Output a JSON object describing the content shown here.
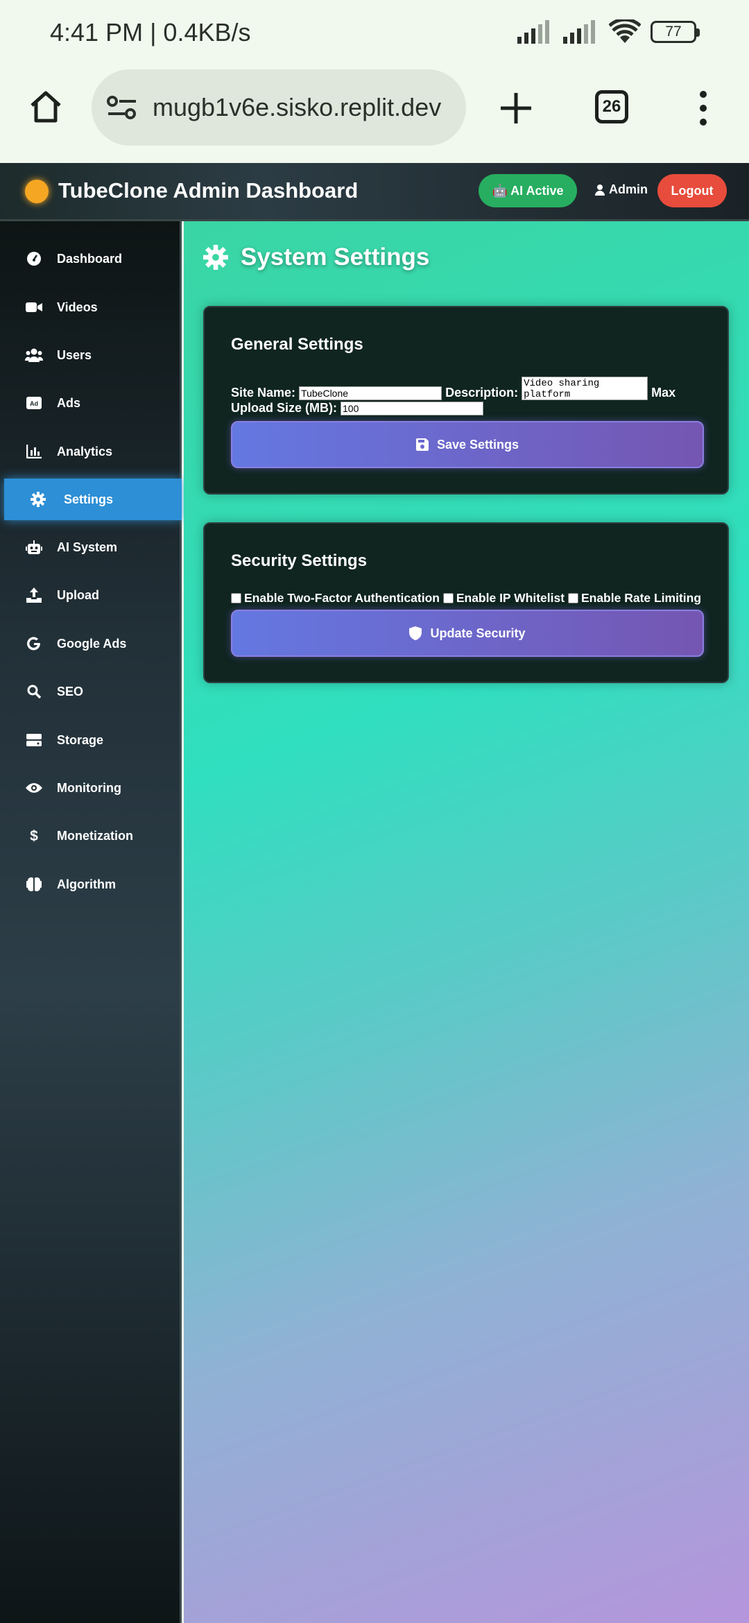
{
  "status_bar": {
    "time": "4:41 PM | 0.4KB/s",
    "battery": "77"
  },
  "browser": {
    "url": "mugb1v6e.sisko.replit.dev",
    "tab_count": "26"
  },
  "header": {
    "title": "TubeClone Admin Dashboard",
    "ai_badge": "🤖 AI Active",
    "admin_label": "Admin",
    "logout_label": "Logout"
  },
  "sidebar": {
    "items": [
      {
        "label": "Dashboard",
        "icon": "gauge-icon"
      },
      {
        "label": "Videos",
        "icon": "video-icon"
      },
      {
        "label": "Users",
        "icon": "users-icon"
      },
      {
        "label": "Ads",
        "icon": "ad-icon"
      },
      {
        "label": "Analytics",
        "icon": "chart-icon"
      },
      {
        "label": "Settings",
        "icon": "gear-icon",
        "active": true
      },
      {
        "label": "AI System",
        "icon": "robot-icon"
      },
      {
        "label": "Upload",
        "icon": "upload-icon"
      },
      {
        "label": "Google Ads",
        "icon": "google-icon"
      },
      {
        "label": "SEO",
        "icon": "search-icon"
      },
      {
        "label": "Storage",
        "icon": "hdd-icon"
      },
      {
        "label": "Monitoring",
        "icon": "eye-icon"
      },
      {
        "label": "Monetization",
        "icon": "dollar-icon"
      },
      {
        "label": "Algorithm",
        "icon": "brain-icon"
      }
    ]
  },
  "page": {
    "title": "System Settings"
  },
  "general": {
    "title": "General Settings",
    "site_name_label": "Site Name:",
    "site_name_value": "TubeClone",
    "description_label": "Description:",
    "description_value": "Video sharing platform",
    "max_upload_label_1": "Max",
    "max_upload_label_2": "Upload Size (MB):",
    "max_upload_value": "100",
    "save_label": "Save Settings"
  },
  "security": {
    "title": "Security Settings",
    "two_factor_label": "Enable Two-Factor Authentication",
    "ip_whitelist_label": "Enable IP Whitelist",
    "rate_limit_label": "Enable Rate Limiting",
    "update_label": "Update Security"
  },
  "colors": {
    "accent": "#2d8fd6",
    "ai_badge": "#27ae60",
    "logout": "#e74c3c",
    "button_start": "#6478e2",
    "button_end": "#7556b2"
  }
}
